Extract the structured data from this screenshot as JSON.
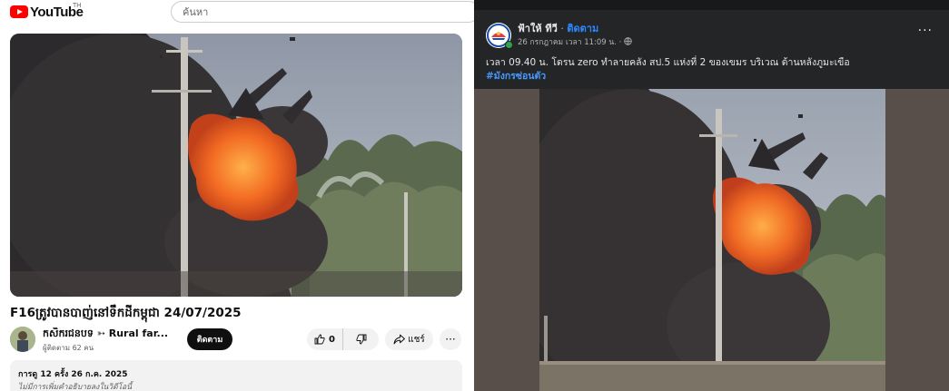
{
  "youtube": {
    "brand": "YouTube",
    "country_code": "TH",
    "search_placeholder": "ค้นหา",
    "video_title": "F16ត្រូវបានបាញ់នៅទឹកដីកម្ពុជា 24/07/2025",
    "channel_name": "កសិករ​ជនបទ ➳ Rural far...",
    "subscribers": "ผู้ติดตาม 62 คน",
    "subscribe_label": "ติดตาม",
    "like_count": "0",
    "share_label": "แชร์",
    "more_label": "···",
    "description_meta": "การดู 12 ครั้ง  26 ก.ค. 2025",
    "description_note": "ไม่มีการเพิ่มคำอธิบายลงในวิดีโอนี้"
  },
  "facebook": {
    "page_name": "ฟ้าให้ ทีวี",
    "separator": " · ",
    "follow_label": "ติดตาม",
    "timestamp": "26 กรกฎาคม เวลา 11:09 น. · ",
    "post_text": "เวลา 09.40 น. โดรน zero ทำลายคลัง สป.5 แห่งที่ 2 ของเขมร บริเวณ ด้านหลังภูมะเขือ",
    "hashtag": "#มังกรซ่อนตัว",
    "more_label": "···"
  },
  "colors": {
    "youtube_red": "#ff0000",
    "facebook_bg": "#242526",
    "facebook_link": "#2d88ff",
    "fire": "#f26a22"
  }
}
